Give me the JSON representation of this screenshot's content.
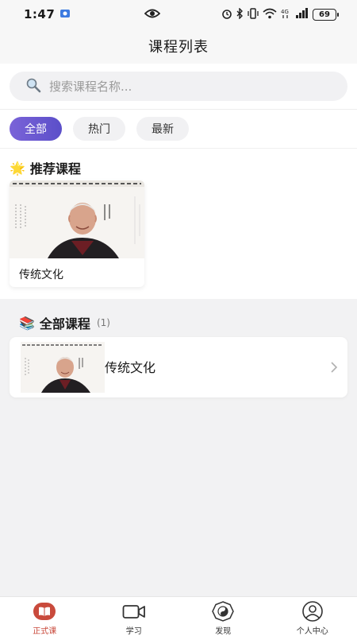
{
  "status_bar": {
    "time": "1:47",
    "battery": "69"
  },
  "header": {
    "title": "课程列表"
  },
  "search": {
    "placeholder": "搜索课程名称..."
  },
  "filters": [
    {
      "label": "全部",
      "active": true
    },
    {
      "label": "热门",
      "active": false
    },
    {
      "label": "最新",
      "active": false
    }
  ],
  "recommended": {
    "emoji": "🌟",
    "title": "推荐课程",
    "cards": [
      {
        "title": "传统文化"
      }
    ]
  },
  "all_courses": {
    "emoji": "📚",
    "title": "全部课程",
    "count": "(1)",
    "items": [
      {
        "title": "传统文化"
      }
    ]
  },
  "tabs": [
    {
      "label": "正式课",
      "icon": "book-icon",
      "active": true
    },
    {
      "label": "学习",
      "icon": "video-camera-icon",
      "active": false
    },
    {
      "label": "发现",
      "icon": "bagua-icon",
      "active": false
    },
    {
      "label": "个人中心",
      "icon": "user-icon",
      "active": false
    }
  ],
  "colors": {
    "accent_start": "#7a63d8",
    "accent_end": "#5b4fc9",
    "tab_active": "#c94a3c"
  }
}
